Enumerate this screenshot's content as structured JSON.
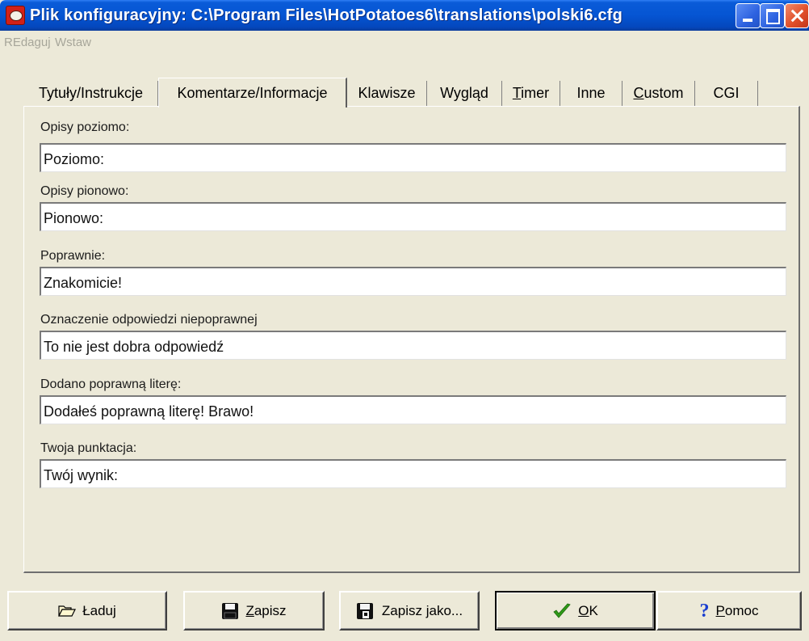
{
  "window": {
    "title": "Plik konfiguracyjny: C:\\Program Files\\HotPotatoes6\\translations\\polski6.cfg"
  },
  "menu": [
    {
      "label": "REdaguj"
    },
    {
      "label": "Wstaw"
    }
  ],
  "tabs": [
    {
      "label": "Tytuły/Instrukcje"
    },
    {
      "label": "Komentarze/Informacje"
    },
    {
      "label": "Klawisze"
    },
    {
      "label": "Wygląd"
    },
    {
      "label_u": "T",
      "label_rest": "imer"
    },
    {
      "label": "Inne"
    },
    {
      "label_u": "C",
      "label_rest": "ustom"
    },
    {
      "label": "CGI"
    }
  ],
  "active_tab_index": 1,
  "fields": [
    {
      "label": "Opisy poziomo:",
      "value": "Poziomo:"
    },
    {
      "label": "Opisy pionowo:",
      "value": "Pionowo:"
    },
    {
      "label": "Poprawnie:",
      "value": "Znakomicie!"
    },
    {
      "label": "Oznaczenie odpowiedzi niepoprawnej",
      "value": "To nie jest dobra odpowiedź"
    },
    {
      "label": "Dodano poprawną literę:",
      "value": "Dodałeś poprawną literę! Brawo!"
    },
    {
      "label": "Twoja punktacja:",
      "value": "Twój wynik:"
    }
  ],
  "buttons": {
    "load": {
      "label": "Ładuj"
    },
    "save": {
      "u": "Z",
      "rest": "apisz"
    },
    "saveas": {
      "pre": "Zapisz ",
      "u": "j",
      "rest": "ako..."
    },
    "ok": {
      "u": "O",
      "rest": "K"
    },
    "help": {
      "u": "P",
      "rest": "omoc"
    }
  },
  "colors": {
    "titlebar": "#0555d3",
    "face": "#ece9d8",
    "ok_check": "#2f9a18",
    "help_icon": "#1a3fd0"
  }
}
